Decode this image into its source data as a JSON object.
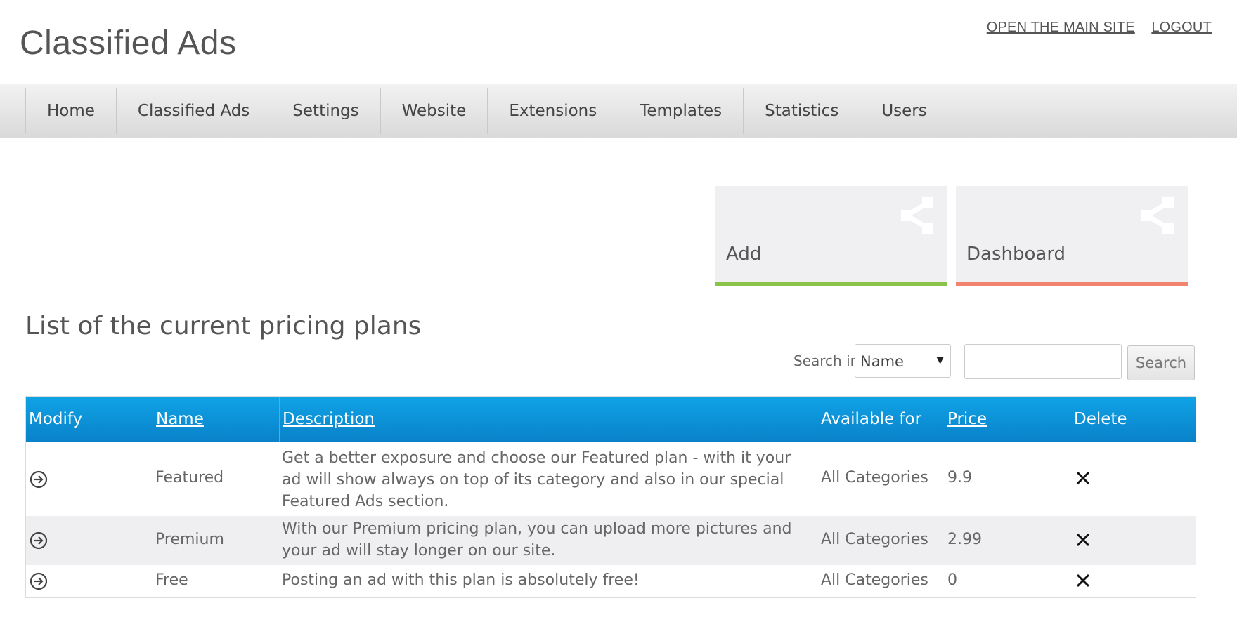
{
  "header": {
    "logo": "Classified Ads",
    "links": [
      "OPEN THE MAIN SITE",
      "LOGOUT"
    ]
  },
  "nav": {
    "items": [
      "Home",
      "Classified Ads",
      "Settings",
      "Website",
      "Extensions",
      "Templates",
      "Statistics",
      "Users"
    ]
  },
  "tiles": [
    {
      "label": "Add",
      "icon": "share-icon",
      "bar_color": "#8bc34a"
    },
    {
      "label": "Dashboard",
      "icon": "share-icon",
      "bar_color": "#f0846e"
    }
  ],
  "page": {
    "title": "List of the current pricing plans"
  },
  "search": {
    "label": "Search in",
    "selected_field": "Name",
    "query": "",
    "button_label": "Search"
  },
  "table": {
    "headers": [
      "Modify",
      "Name",
      "Description",
      "Available for",
      "Price",
      "Delete"
    ],
    "rows": [
      {
        "name": "Featured",
        "description": "Get a better exposure and choose our Featured plan - with it your ad will show always on top of its category and also in our special Featured Ads section.",
        "available_for": "All Categories",
        "price": "9.9"
      },
      {
        "name": "Premium",
        "description": "With our Premium pricing plan, you can upload more pictures and your ad will stay longer on our site.",
        "available_for": "All Categories",
        "price": "2.99"
      },
      {
        "name": "Free",
        "description": "Posting an ad with this plan is absolutely free!",
        "available_for": "All Categories",
        "price": "0"
      }
    ]
  },
  "colors": {
    "table_header": "#0a8fd6",
    "add_bar": "#8bc34a",
    "dashboard_bar": "#f0846e"
  }
}
